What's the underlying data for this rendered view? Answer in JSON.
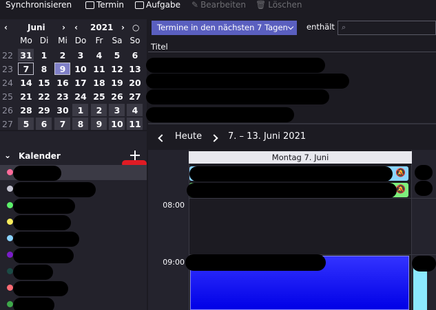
{
  "toolbar": {
    "sync": "Synchronisieren",
    "termin": "Termin",
    "aufgabe": "Aufgabe",
    "bearbeiten": "Bearbeiten",
    "loeschen": "Löschen"
  },
  "minical": {
    "month": "Juni",
    "year": "2021",
    "weekdays": [
      "Mo",
      "Di",
      "Mi",
      "Do",
      "Fr",
      "Sa",
      "So"
    ],
    "weeks": [
      {
        "wk": "22",
        "days": [
          "31",
          "1",
          "2",
          "3",
          "4",
          "5",
          "6"
        ]
      },
      {
        "wk": "23",
        "days": [
          "7",
          "8",
          "9",
          "10",
          "11",
          "12",
          "13"
        ]
      },
      {
        "wk": "24",
        "days": [
          "14",
          "15",
          "16",
          "17",
          "18",
          "19",
          "20"
        ]
      },
      {
        "wk": "25",
        "days": [
          "21",
          "22",
          "23",
          "24",
          "25",
          "26",
          "27"
        ]
      },
      {
        "wk": "26",
        "days": [
          "28",
          "29",
          "30",
          "1",
          "2",
          "3",
          "4"
        ]
      },
      {
        "wk": "27",
        "days": [
          "5",
          "6",
          "7",
          "8",
          "9",
          "10",
          "11"
        ]
      }
    ]
  },
  "calendars": {
    "title": "Kalender",
    "colors": [
      "#ff6b9a",
      "#c5c5d2",
      "#5cf06a",
      "#f8ec5c",
      "#8ad4ff",
      "#7a1cc8",
      "#1b4b45",
      "#ff6b74",
      "#3ea84a"
    ]
  },
  "filter": {
    "selected": "Termine in den nächsten 7 Tagen",
    "contains": "enthält"
  },
  "list": {
    "column": "Titel"
  },
  "week": {
    "today": "Heute",
    "range": "7. – 13. Juni 2021"
  },
  "day": {
    "header": "Montag 7. Juni",
    "times": [
      "08:00",
      "09:00"
    ]
  }
}
